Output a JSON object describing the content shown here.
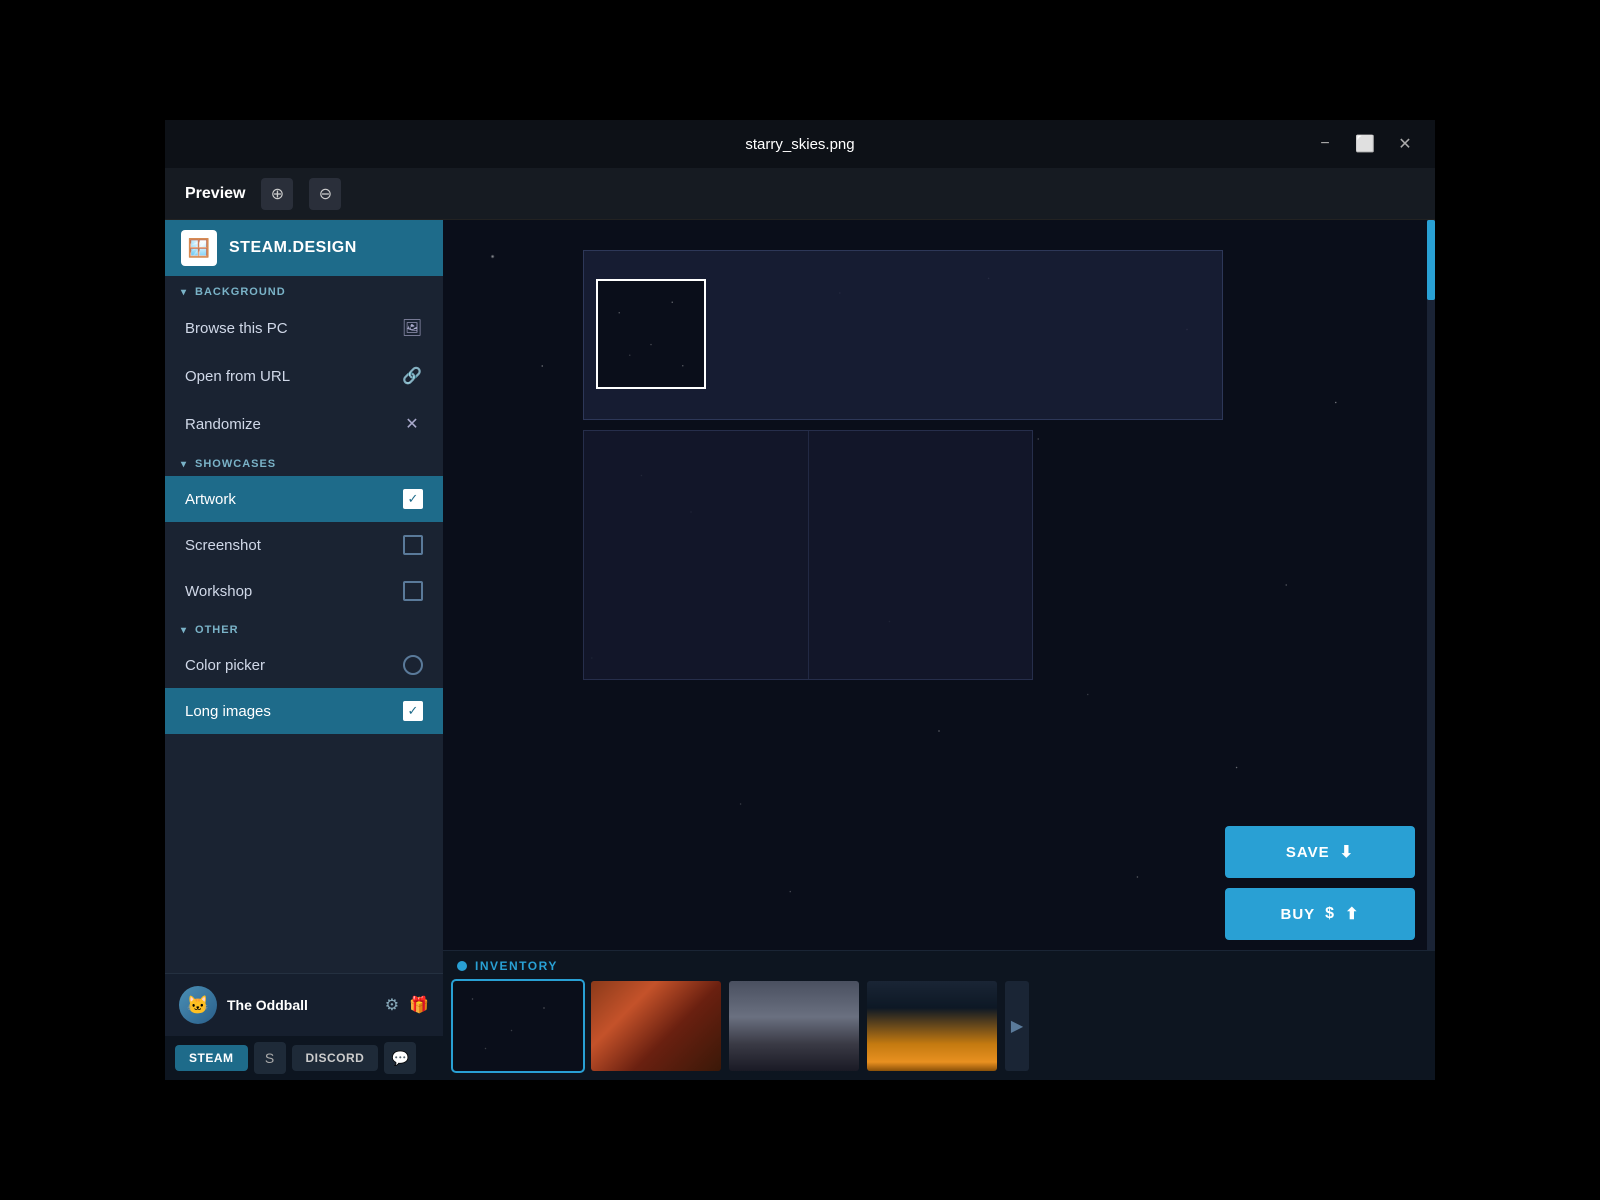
{
  "app": {
    "title": "STEAM.DESIGN",
    "logo_icon": "🪟"
  },
  "titlebar": {
    "filename": "starry_skies.png",
    "minimize_label": "−",
    "maximize_label": "⬜",
    "close_label": "✕"
  },
  "preview": {
    "label": "Preview",
    "zoom_in_label": "🔍+",
    "zoom_out_label": "🔍−"
  },
  "sidebar": {
    "background_section": "BACKGROUND",
    "browse_label": "Browse this PC",
    "openurl_label": "Open from URL",
    "randomize_label": "Randomize",
    "showcases_section": "SHOWCASES",
    "artwork_label": "Artwork",
    "screenshot_label": "Screenshot",
    "workshop_label": "Workshop",
    "other_section": "OTHER",
    "colorpicker_label": "Color picker",
    "longimages_label": "Long images"
  },
  "user": {
    "name": "The Oddball",
    "avatar_emoji": "🐱"
  },
  "platforms": {
    "steam_label": "STEAM",
    "icon1": "S",
    "discord_label": "DISCORD",
    "icon2": "💬"
  },
  "inventory": {
    "label": "INVENTORY"
  },
  "buttons": {
    "save_label": "SAVE",
    "buy_label": "BUY",
    "download_icon": "⬇",
    "share_icon": "⬆",
    "dollar_icon": "$"
  }
}
